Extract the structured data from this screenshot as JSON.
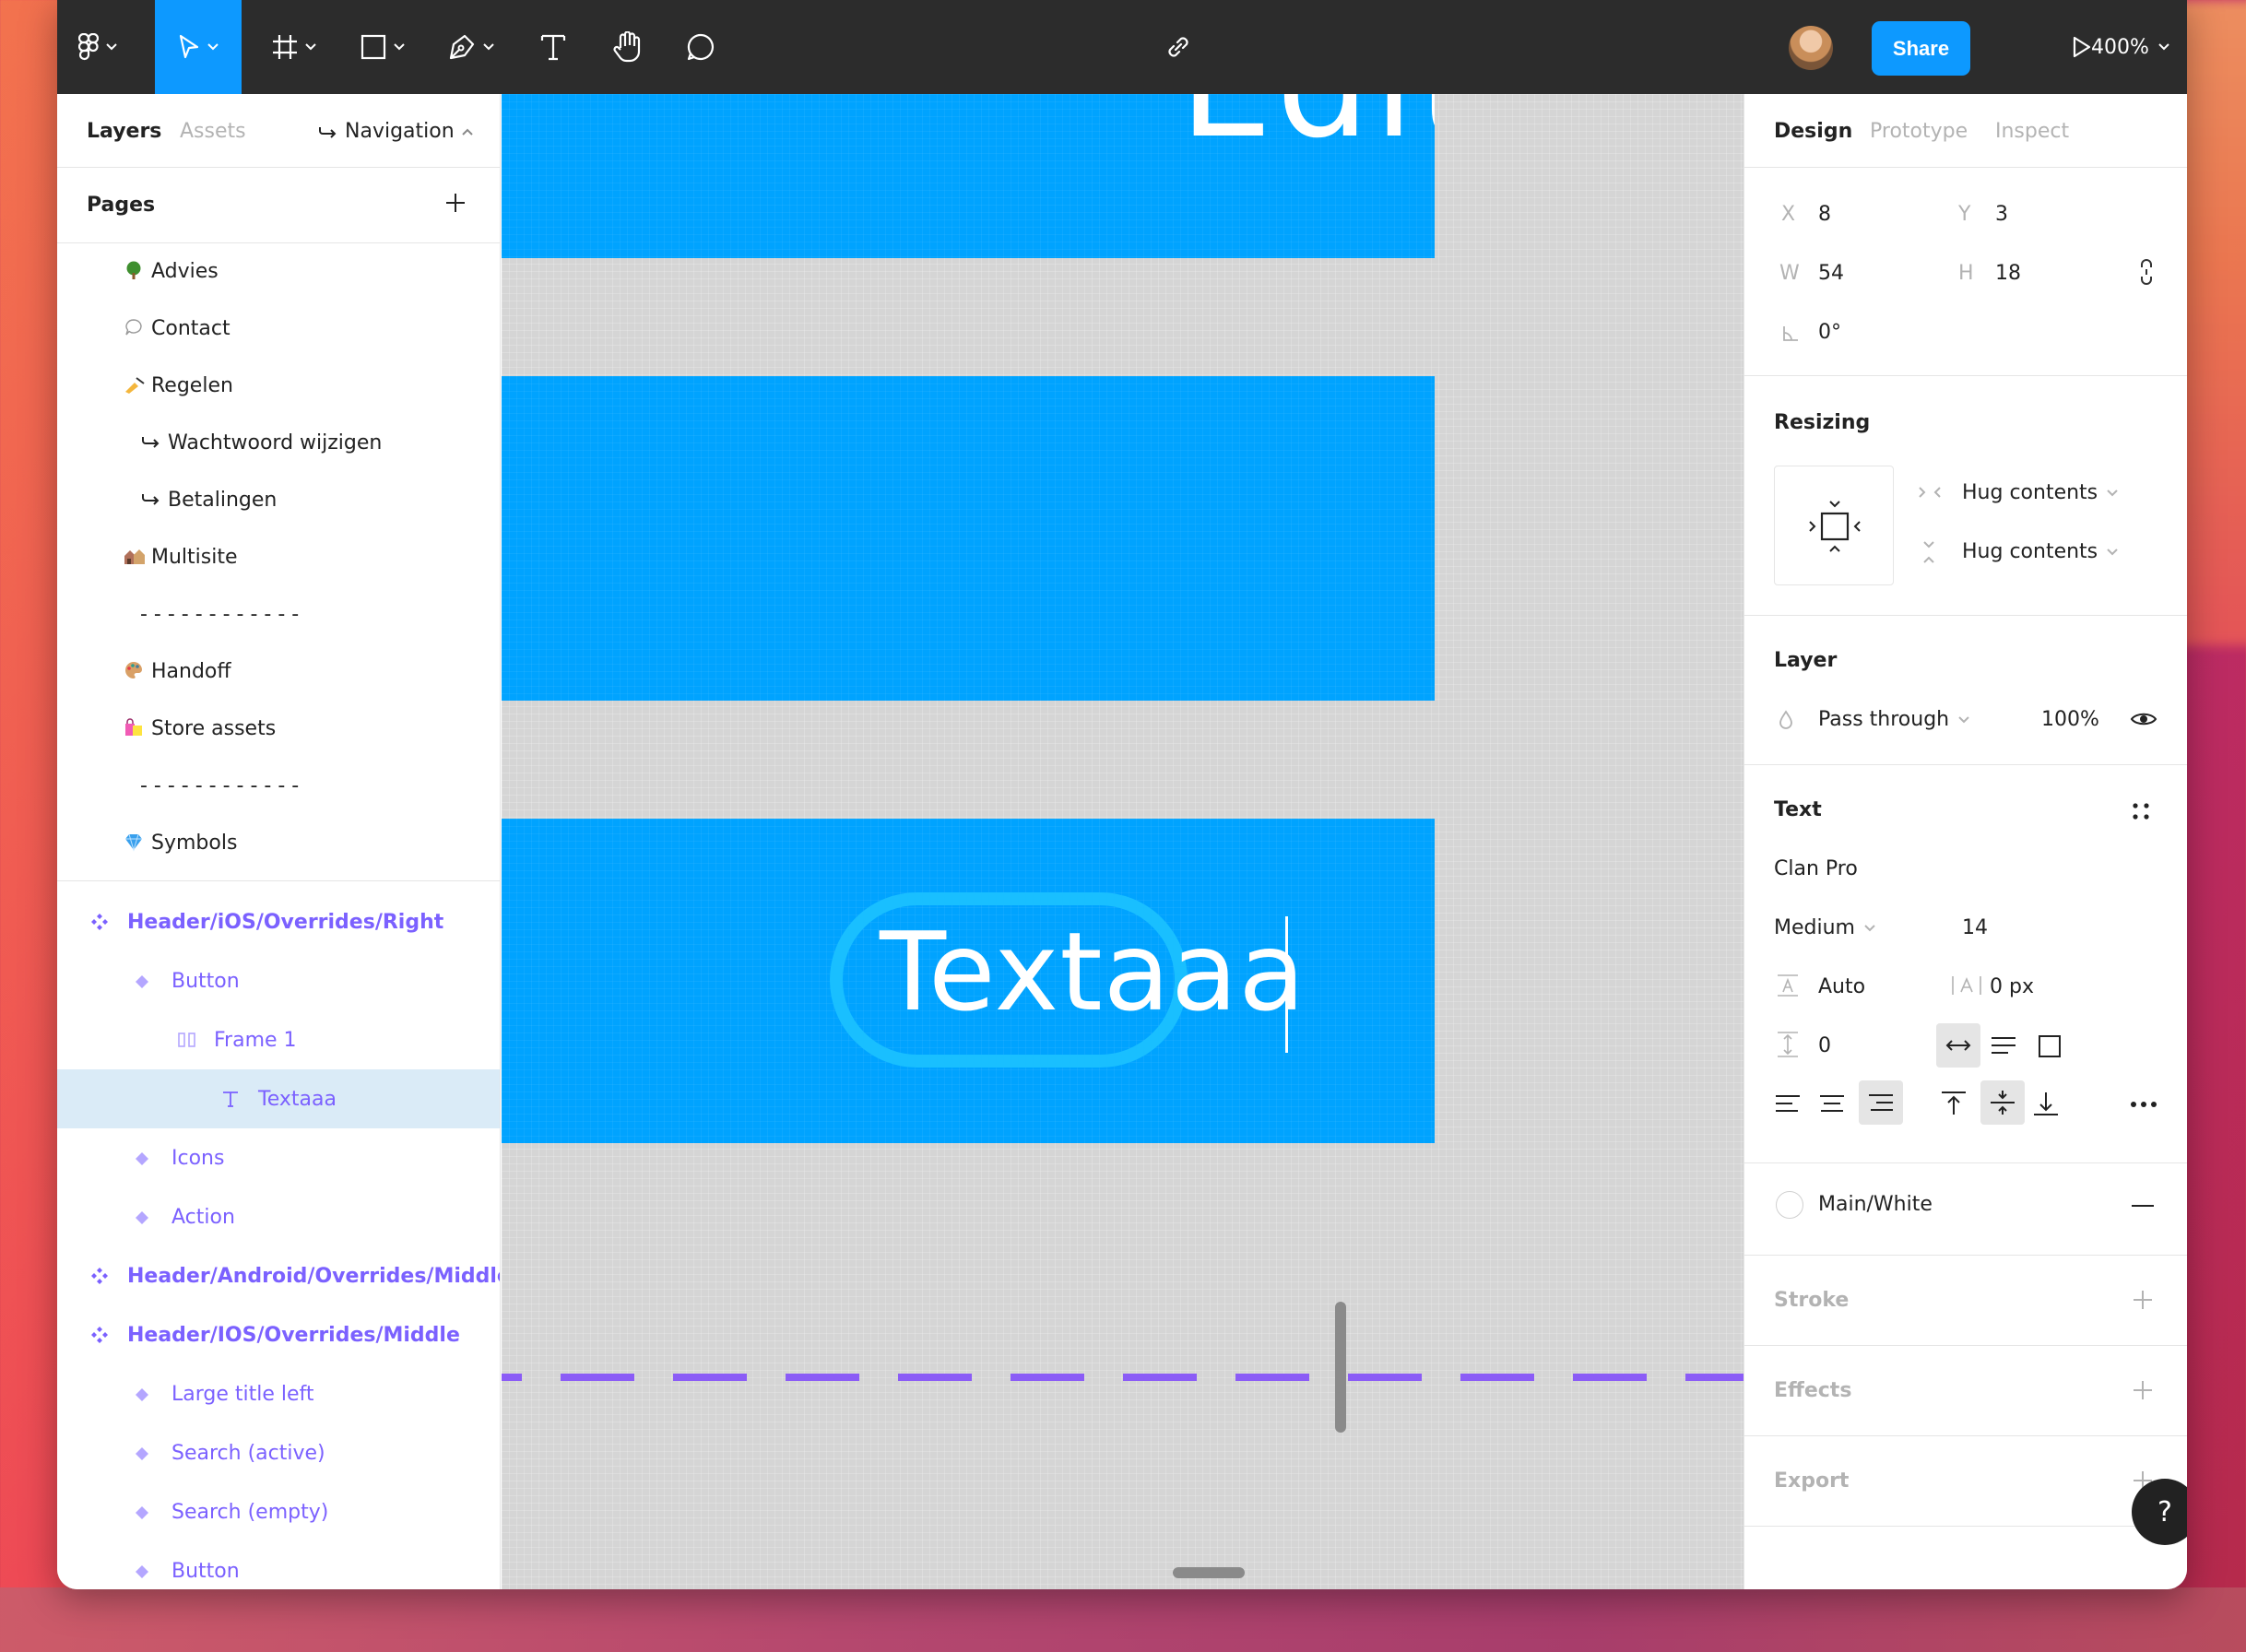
{
  "toolbar": {
    "share_label": "Share",
    "zoom_label": "400%",
    "tools": [
      "figma-menu",
      "move-tool",
      "frame-tool",
      "shape-tool",
      "pen-tool",
      "text-tool",
      "hand-tool",
      "comment-tool"
    ],
    "accent": "#0d99ff"
  },
  "left": {
    "tabs": {
      "layers": "Layers",
      "assets": "Assets",
      "navigation": "Navigation"
    },
    "pages_title": "Pages",
    "pages": [
      {
        "label": "Advies",
        "icon": "tree-icon"
      },
      {
        "label": "Contact",
        "icon": "speech-bubble-icon"
      },
      {
        "label": "Regelen",
        "icon": "writing-hand-icon"
      },
      {
        "label": "Wachtwoord wijzigen",
        "icon": "link-arrow-icon"
      },
      {
        "label": "Betalingen",
        "icon": "link-arrow-icon"
      },
      {
        "label": "Multisite",
        "icon": "houses-icon"
      },
      {
        "label": "- - - - - - - - - - - -",
        "icon": ""
      },
      {
        "label": "Handoff",
        "icon": "palette-icon"
      },
      {
        "label": "Store assets",
        "icon": "shopping-bags-icon"
      },
      {
        "label": "- - - - - - - - - - - -",
        "icon": ""
      },
      {
        "label": "Symbols",
        "icon": "gem-icon"
      }
    ],
    "layers": [
      {
        "label": "Header/iOS/Overrides/Right",
        "icon": "component-icon"
      },
      {
        "label": "Button",
        "icon": "instance-icon"
      },
      {
        "label": "Frame 1",
        "icon": "auto-layout-icon"
      },
      {
        "label": "Textaaa",
        "icon": "text-layer-icon"
      },
      {
        "label": "Icons",
        "icon": "instance-icon"
      },
      {
        "label": "Action",
        "icon": "instance-icon"
      },
      {
        "label": "Header/Android/Overrides/Middle",
        "icon": "component-icon"
      },
      {
        "label": "Header/IOS/Overrides/Middle",
        "icon": "component-icon"
      },
      {
        "label": "Large title left",
        "icon": "instance-icon"
      },
      {
        "label": "Search (active)",
        "icon": "instance-icon"
      },
      {
        "label": "Search (empty)",
        "icon": "instance-icon"
      },
      {
        "label": "Button",
        "icon": "instance-icon"
      }
    ]
  },
  "canvas": {
    "top_frame_text": "Edit",
    "selected_text": "Textaaa",
    "frame_color": "#00a3ff",
    "guide_color": "#8b5cf6"
  },
  "right": {
    "tabs": {
      "design": "Design",
      "prototype": "Prototype",
      "inspect": "Inspect"
    },
    "position": {
      "x_label": "X",
      "x": "8",
      "y_label": "Y",
      "y": "3",
      "w_label": "W",
      "w": "54",
      "h_label": "H",
      "h": "18",
      "rotation": "0°"
    },
    "resizing": {
      "title": "Resizing",
      "horizontal": "Hug contents",
      "vertical": "Hug contents"
    },
    "layer": {
      "title": "Layer",
      "blend": "Pass through",
      "opacity": "100%"
    },
    "text": {
      "title": "Text",
      "font": "Clan Pro",
      "weight": "Medium",
      "size": "14",
      "line_height": "Auto",
      "letter_spacing": "0 px",
      "paragraph_spacing": "0"
    },
    "fill": {
      "style": "Main/White"
    },
    "stroke_title": "Stroke",
    "effects_title": "Effects",
    "export_title": "Export"
  },
  "help_label": "?"
}
